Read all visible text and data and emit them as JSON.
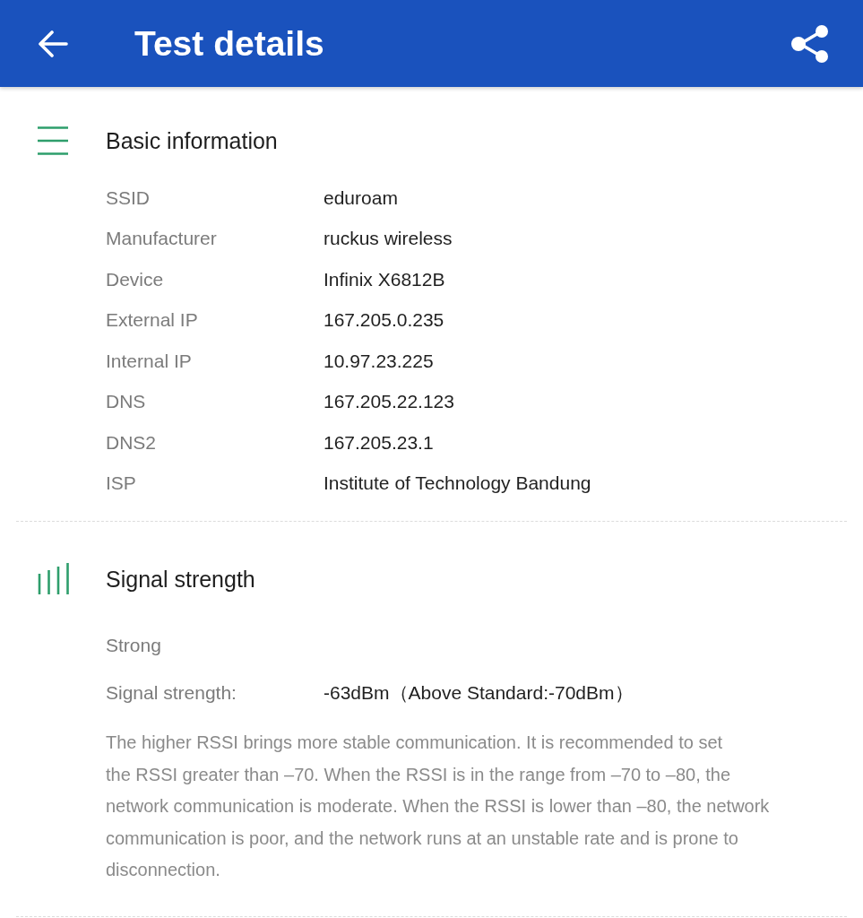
{
  "header": {
    "title": "Test details"
  },
  "sections": [
    {
      "kind": "info",
      "title": "Basic information",
      "rows": [
        {
          "label": "SSID",
          "value": "eduroam"
        },
        {
          "label": "Manufacturer",
          "value": "ruckus wireless"
        },
        {
          "label": "Device",
          "value": "Infinix X6812B"
        },
        {
          "label": "External IP",
          "value": "167.205.0.235"
        },
        {
          "label": "Internal IP",
          "value": "10.97.23.225"
        },
        {
          "label": "DNS",
          "value": "167.205.22.123"
        },
        {
          "label": "DNS2",
          "value": "167.205.23.1"
        },
        {
          "label": "ISP",
          "value": "Institute of Technology Bandung"
        }
      ]
    },
    {
      "kind": "signal",
      "title": "Signal strength",
      "rating": "Strong",
      "rows": [
        {
          "label": "Signal strength:",
          "value": "-63dBm（Above Standard:-70dBm）"
        }
      ],
      "description": "The higher RSSI brings more stable communication. It is recommended to set\nthe RSSI greater than –70. When the RSSI is in the range from –70 to –80, the\nnetwork communication is moderate. When the RSSI is lower than –80, the network communication is poor, and the network runs at an unstable rate and is prone to disconnection."
    }
  ]
}
